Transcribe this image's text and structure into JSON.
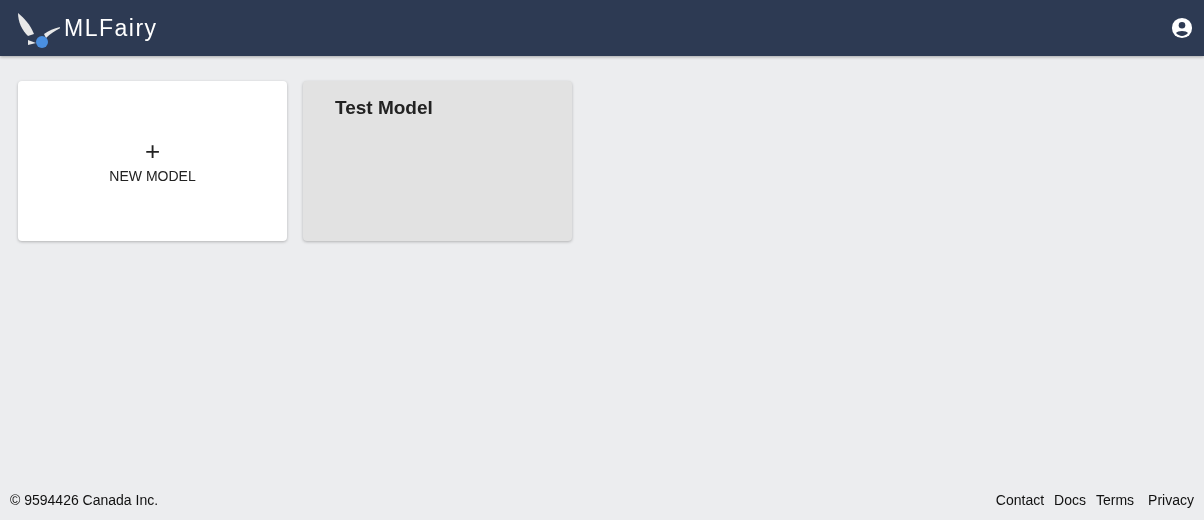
{
  "header": {
    "title": "MLFairy"
  },
  "cards": [
    {
      "kind": "new",
      "icon": "+",
      "label": "NEW MODEL",
      "hovered": false
    },
    {
      "kind": "model",
      "label": "Test Model",
      "hovered": true
    }
  ],
  "footer": {
    "copyright": "© 9594426 Canada Inc.",
    "links": [
      "Contact",
      "Docs",
      "Terms",
      "Privacy"
    ]
  }
}
